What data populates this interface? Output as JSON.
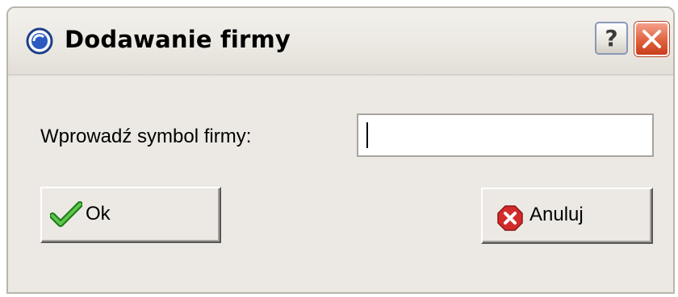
{
  "window": {
    "title": "Dodawanie firmy",
    "help_label": "?"
  },
  "form": {
    "prompt_label": "Wprowadź symbol firmy:",
    "symbol_value": "",
    "symbol_placeholder": ""
  },
  "buttons": {
    "ok_label": "Ok",
    "cancel_label": "Anuluj"
  },
  "icons": {
    "app": "app-icon",
    "help": "help-icon",
    "close": "close-icon",
    "ok": "checkmark-icon",
    "cancel": "cancel-icon"
  },
  "colors": {
    "dialog_bg": "#ece9e4",
    "close_red": "#e0623e",
    "ok_green": "#2e9e2a",
    "cancel_red": "#d32a2a"
  }
}
